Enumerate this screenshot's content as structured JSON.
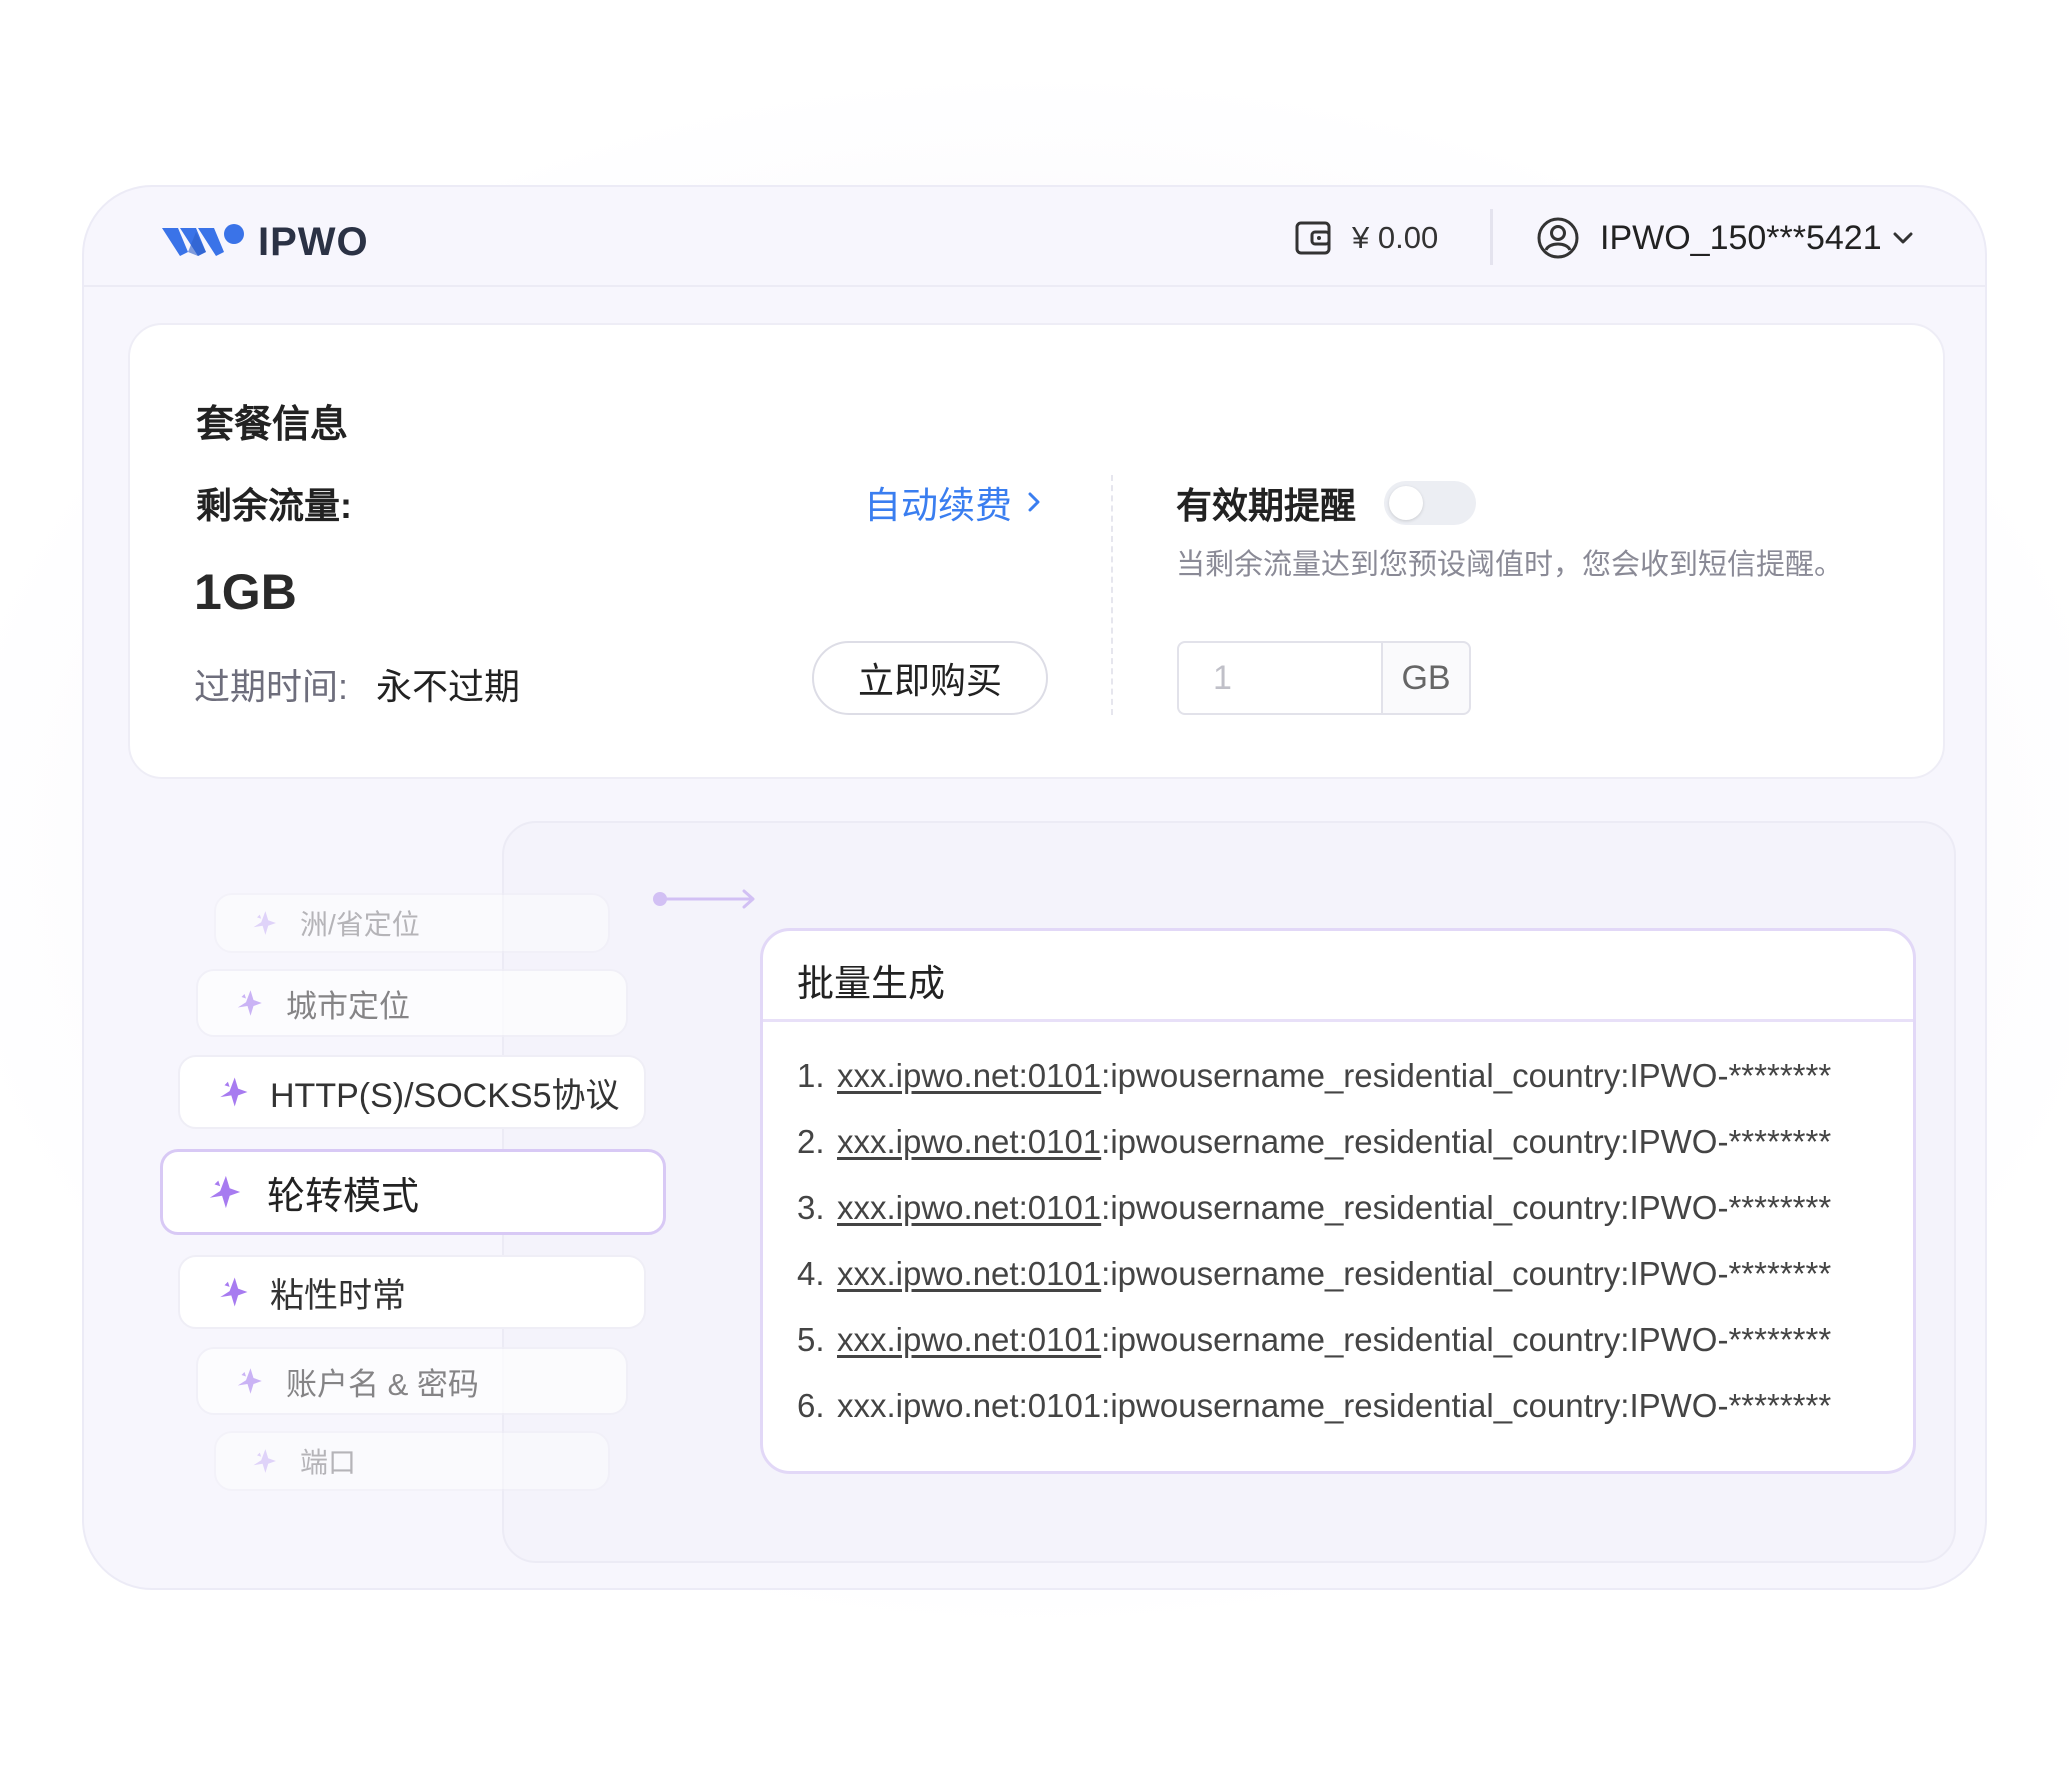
{
  "header": {
    "logo_text": "IPWO",
    "wallet_balance": "¥ 0.00",
    "username": "IPWO_150***5421"
  },
  "package": {
    "title": "套餐信息",
    "remaining_label": "剩余流量:",
    "auto_renew_label": "自动续费",
    "remaining_value": "1GB",
    "expiry_label": "过期时间:",
    "expiry_value": "永不过期",
    "buy_button": "立即购买"
  },
  "reminder": {
    "title": "有效期提醒",
    "toggle_on": false,
    "description": "当剩余流量达到您预设阈值时，您会收到短信提醒。",
    "threshold_placeholder": "1",
    "unit": "GB"
  },
  "features": [
    {
      "label": "洲/省定位",
      "emphasis": "faint"
    },
    {
      "label": "城市定位",
      "emphasis": "dim"
    },
    {
      "label": "HTTP(S)/SOCKS5协议",
      "emphasis": "normal"
    },
    {
      "label": "轮转模式",
      "emphasis": "active"
    },
    {
      "label": "粘性时常",
      "emphasis": "normal"
    },
    {
      "label": "账户名 & 密码",
      "emphasis": "dim"
    },
    {
      "label": "端口",
      "emphasis": "faint"
    }
  ],
  "batch": {
    "title": "批量生成",
    "lines": [
      {
        "num": "1.",
        "host": "xxx.ipwo.net:0101",
        "rest": ":ipwousername_residential_country:IPWO-********",
        "underlined": true
      },
      {
        "num": "2.",
        "host": "xxx.ipwo.net:0101",
        "rest": ":ipwousername_residential_country:IPWO-********",
        "underlined": true
      },
      {
        "num": "3.",
        "host": "xxx.ipwo.net:0101",
        "rest": ":ipwousername_residential_country:IPWO-********",
        "underlined": true
      },
      {
        "num": "4.",
        "host": "xxx.ipwo.net:0101",
        "rest": ":ipwousername_residential_country:IPWO-********",
        "underlined": true
      },
      {
        "num": "5.",
        "host": "xxx.ipwo.net:0101",
        "rest": ":ipwousername_residential_country:IPWO-********",
        "underlined": true
      },
      {
        "num": "6.",
        "host": "xxx.ipwo.net:0101",
        "rest": ":ipwousername_residential_country:IPWO-********",
        "underlined": false
      }
    ]
  },
  "colors": {
    "accent_blue": "#3a7ef0",
    "logo_blue": "#3a73e8",
    "active_border": "#d8c9f5",
    "star_purple": "#a77bf0"
  },
  "icons": [
    "logo-icon",
    "wallet-icon",
    "user-avatar-icon",
    "chevron-down-icon",
    "chevron-right-icon",
    "sparkle-icon"
  ]
}
